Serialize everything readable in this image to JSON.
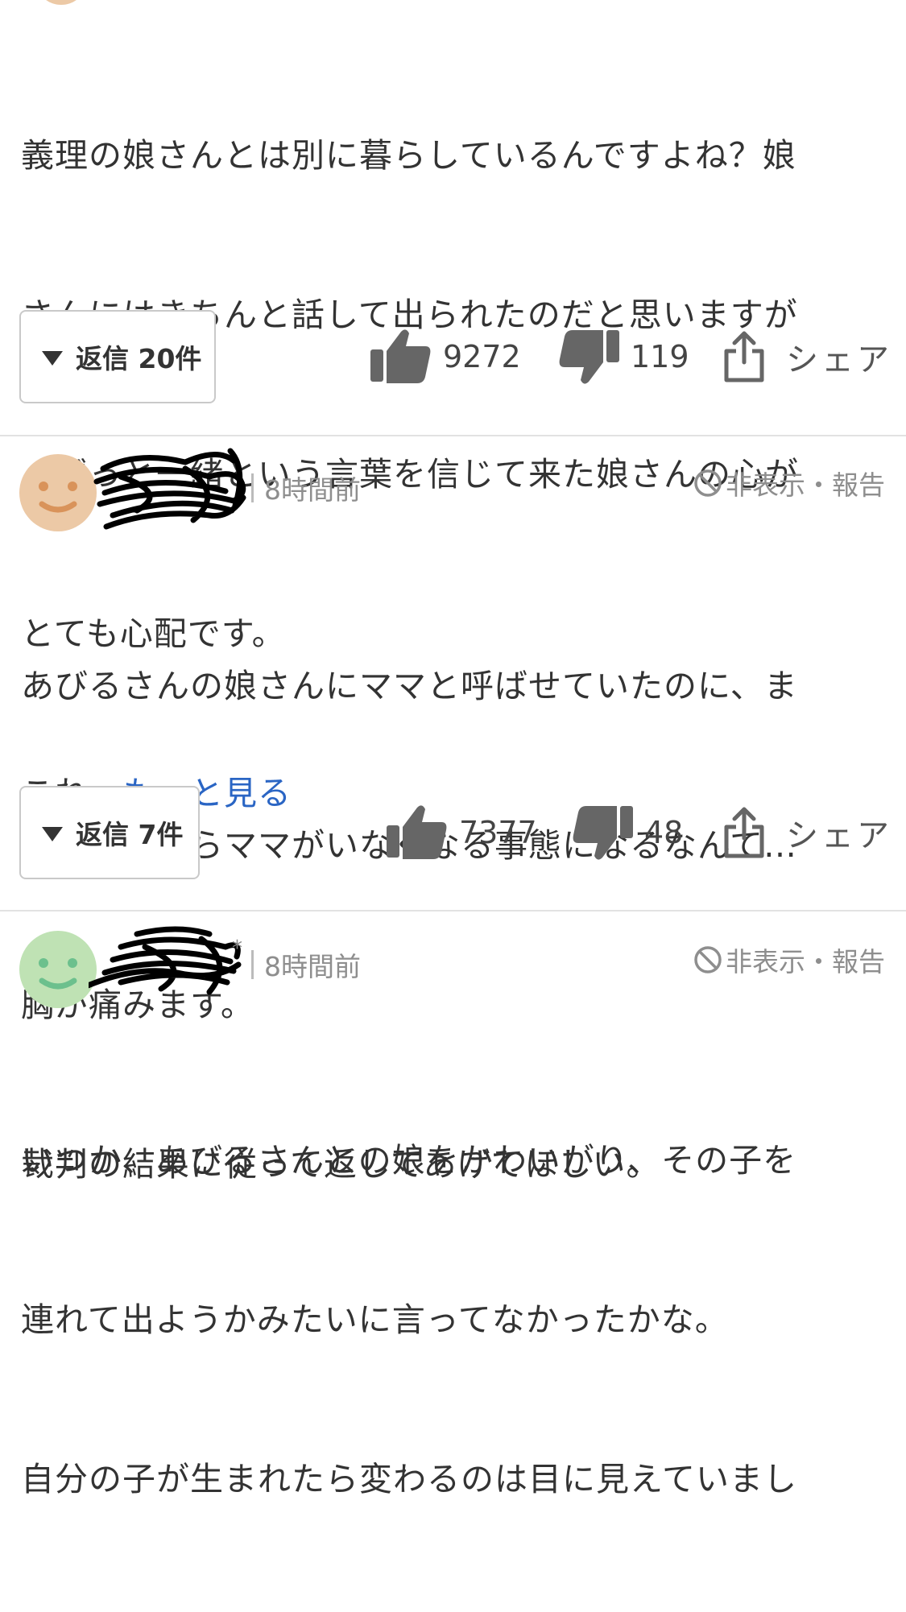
{
  "comment1": {
    "lines": [
      "義理の娘さんとは別に暮らしているんですよね？娘",
      "さんにはきちんと話して出られたのだと思いますが",
      "、ずっと一緒という言葉を信じて来た娘さんの心が",
      "とても心配です。"
    ],
    "last_prefix": "これ",
    "more_link": "…もっと見る",
    "reply_label": "返信 20件",
    "likes": "9272",
    "dislikes": "119",
    "share_label": "シェア"
  },
  "comment2": {
    "time": "8時間前",
    "report_label": "非表示・報告",
    "avatar_color": "#ecc9a6",
    "avatar_face_color": "#d9935a",
    "lines": [
      "あびるさんの娘さんにママと呼ばせていたのに、ま",
      "た娘さんからママがいなくなる事態になるなんて…",
      "胸が痛みます。",
      "裁判の結果に従って返してあげてほしい。"
    ],
    "reply_label": "返信 7件",
    "likes": "7377",
    "dislikes": "48",
    "share_label": "シェア"
  },
  "comment3": {
    "time": "8時間前",
    "report_label": "非表示・報告",
    "avatar_color": "#bfe2b4",
    "avatar_face_color": "#6cc08d",
    "lines": [
      "いつか、あびるさんとの娘をかわいがり、その子を",
      "連れて出ようかみたいに言ってなかったかな。",
      "自分の子が生まれたら変わるのは目に見えていまし"
    ]
  }
}
